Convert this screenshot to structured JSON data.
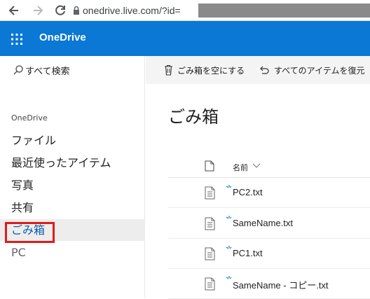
{
  "browser": {
    "url": "onedrive.live.com/?id="
  },
  "suite": {
    "brand": "OneDrive",
    "color": "#0a78d4"
  },
  "search": {
    "label": "すべて検索"
  },
  "nav": {
    "section": "OneDrive",
    "items": [
      {
        "label": "ファイル"
      },
      {
        "label": "最近使ったアイテム"
      },
      {
        "label": "写真"
      },
      {
        "label": "共有"
      },
      {
        "label": "ごみ箱"
      },
      {
        "label": "PC"
      }
    ]
  },
  "commands": {
    "empty_recycle": "ごみ箱を空にする",
    "restore_all": "すべてのアイテムを復元"
  },
  "page": {
    "title": "ごみ箱"
  },
  "list": {
    "name_header": "名前",
    "files": [
      {
        "name": "PC2.txt"
      },
      {
        "name": "SameName.txt"
      },
      {
        "name": "PC1.txt"
      },
      {
        "name": "SameName - コピー.txt"
      }
    ]
  },
  "colors": {
    "accent": "#0a78d4",
    "highlight": "#e01b1b"
  }
}
